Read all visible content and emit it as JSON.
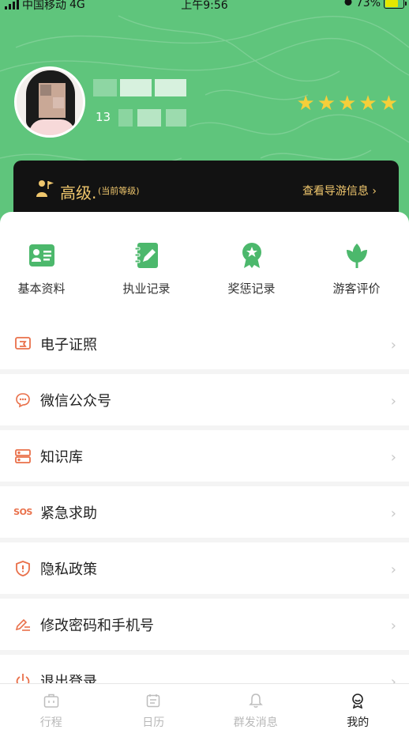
{
  "status_bar": {
    "carrier": "中国移动",
    "network": "4G",
    "time": "上午9:56",
    "battery": "73%"
  },
  "profile": {
    "phone_prefix": "13",
    "rating_stars": 5,
    "level_label": "高级.",
    "level_note": "(当前等级)",
    "view_guide_label": "查看导游信息 ›"
  },
  "quick_actions": [
    {
      "label": "基本资料",
      "icon": "id-card-icon"
    },
    {
      "label": "执业记录",
      "icon": "notebook-pen-icon"
    },
    {
      "label": "奖惩记录",
      "icon": "award-ribbon-icon"
    },
    {
      "label": "游客评价",
      "icon": "leaf-icon"
    }
  ],
  "menu": [
    {
      "label": "电子证照",
      "icon": "certificate-icon"
    },
    {
      "label": "微信公众号",
      "icon": "chat-bubble-icon"
    },
    {
      "label": "知识库",
      "icon": "server-icon"
    },
    {
      "label": "紧急求助",
      "icon": "sos-icon",
      "icon_text": "SOS"
    },
    {
      "label": "隐私政策",
      "icon": "shield-icon"
    },
    {
      "label": "修改密码和手机号",
      "icon": "pencil-lines-icon"
    },
    {
      "label": "退出登录",
      "icon": "power-icon"
    }
  ],
  "chevron": "›",
  "tabbar": [
    {
      "label": "行程",
      "icon": "briefcase-icon",
      "active": false
    },
    {
      "label": "日历",
      "icon": "calendar-icon",
      "active": false
    },
    {
      "label": "群发消息",
      "icon": "bell-icon",
      "active": false
    },
    {
      "label": "我的",
      "icon": "user-badge-icon",
      "active": true
    }
  ],
  "colors": {
    "header_green": "#5fc57c",
    "accent_green": "#4cb86c",
    "gold": "#f0c76d",
    "star": "#f5cf3a",
    "menu_icon_orange": "#e9704a"
  }
}
